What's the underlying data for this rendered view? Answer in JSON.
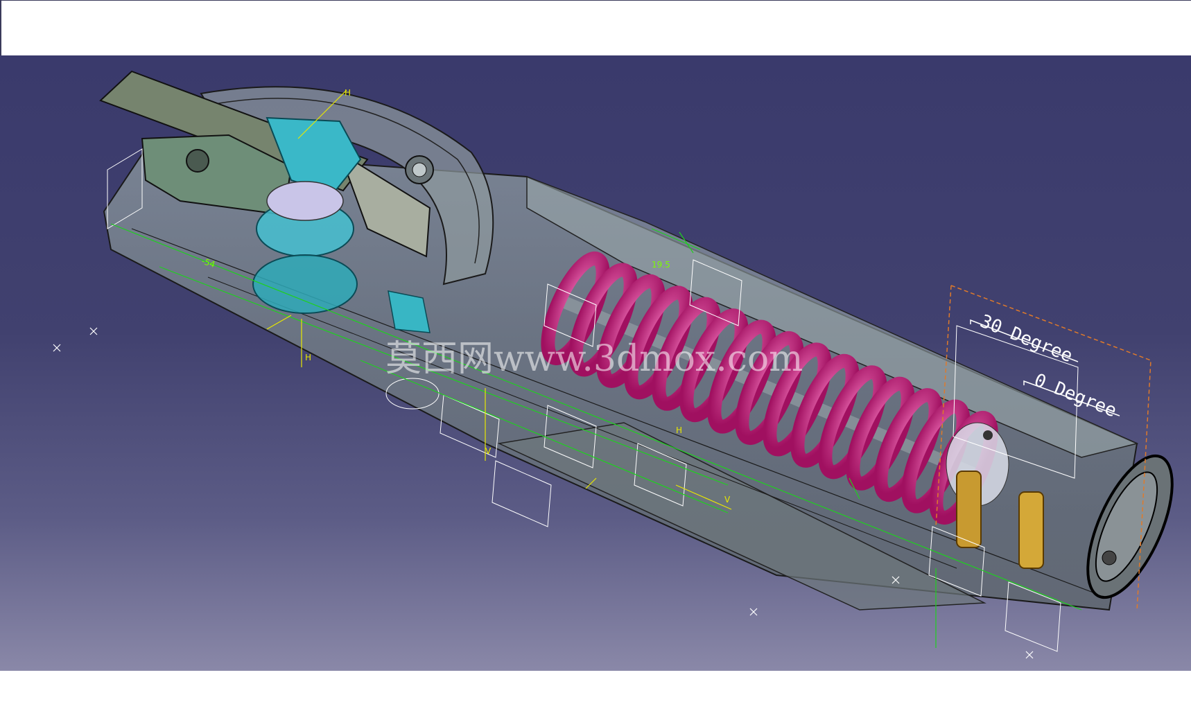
{
  "annotations": {
    "angle_30": "30 Degree",
    "angle_0": "0 Degree"
  },
  "dimensions": {
    "d1": "-54",
    "d2": "19.5"
  },
  "axis_letters": {
    "h": "H",
    "v": "V"
  },
  "watermark": "莫西网www.3dmox.com",
  "colors": {
    "background_top": "#3a3a6c",
    "background_bottom": "#8a88a8",
    "spring": "#d0208a",
    "constraint": "#1fd01f",
    "axis": "#e8e800",
    "housing": "#7a8a8a",
    "gear": "#3ab8c8"
  }
}
